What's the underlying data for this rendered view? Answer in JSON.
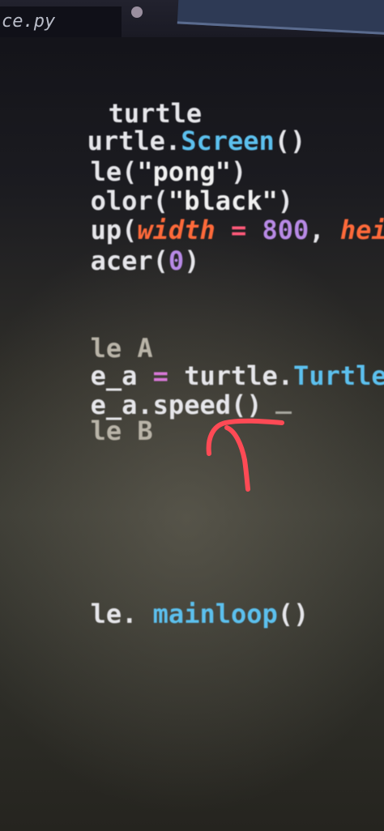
{
  "tab": {
    "filename": "ce.py"
  },
  "code_lines": [
    {
      "parts": [
        "turtle"
      ]
    },
    {
      "parts": [
        "urtle.",
        "Screen",
        "()"
      ]
    },
    {
      "parts": [
        "le(",
        "\"pong\"",
        ")"
      ]
    },
    {
      "parts": [
        "olor(",
        "\"black\"",
        ")"
      ]
    },
    {
      "parts": [
        "up(",
        "width",
        " = ",
        "800",
        ", ",
        "height"
      ]
    },
    {
      "parts": [
        "acer(",
        "0",
        ")"
      ]
    },
    {
      "parts": [
        "le A"
      ]
    },
    {
      "parts": [
        "e_a",
        " = ",
        "turtle.",
        "Turtle",
        "()"
      ]
    },
    {
      "parts": [
        "e_a.speed()"
      ]
    },
    {
      "parts": [
        "le B"
      ]
    },
    {
      "parts": [
        "le. ",
        "mainloop",
        "()"
      ]
    }
  ],
  "colors": {
    "background": "#2b2a26",
    "keyword": "#5cc0ee",
    "string": "#f2f2f2",
    "number": "#b88ae6",
    "param": "#ff6a3a",
    "annotation": "#ff4a55"
  },
  "icons": {
    "annotation": "hand-drawn-arrow-icon"
  }
}
